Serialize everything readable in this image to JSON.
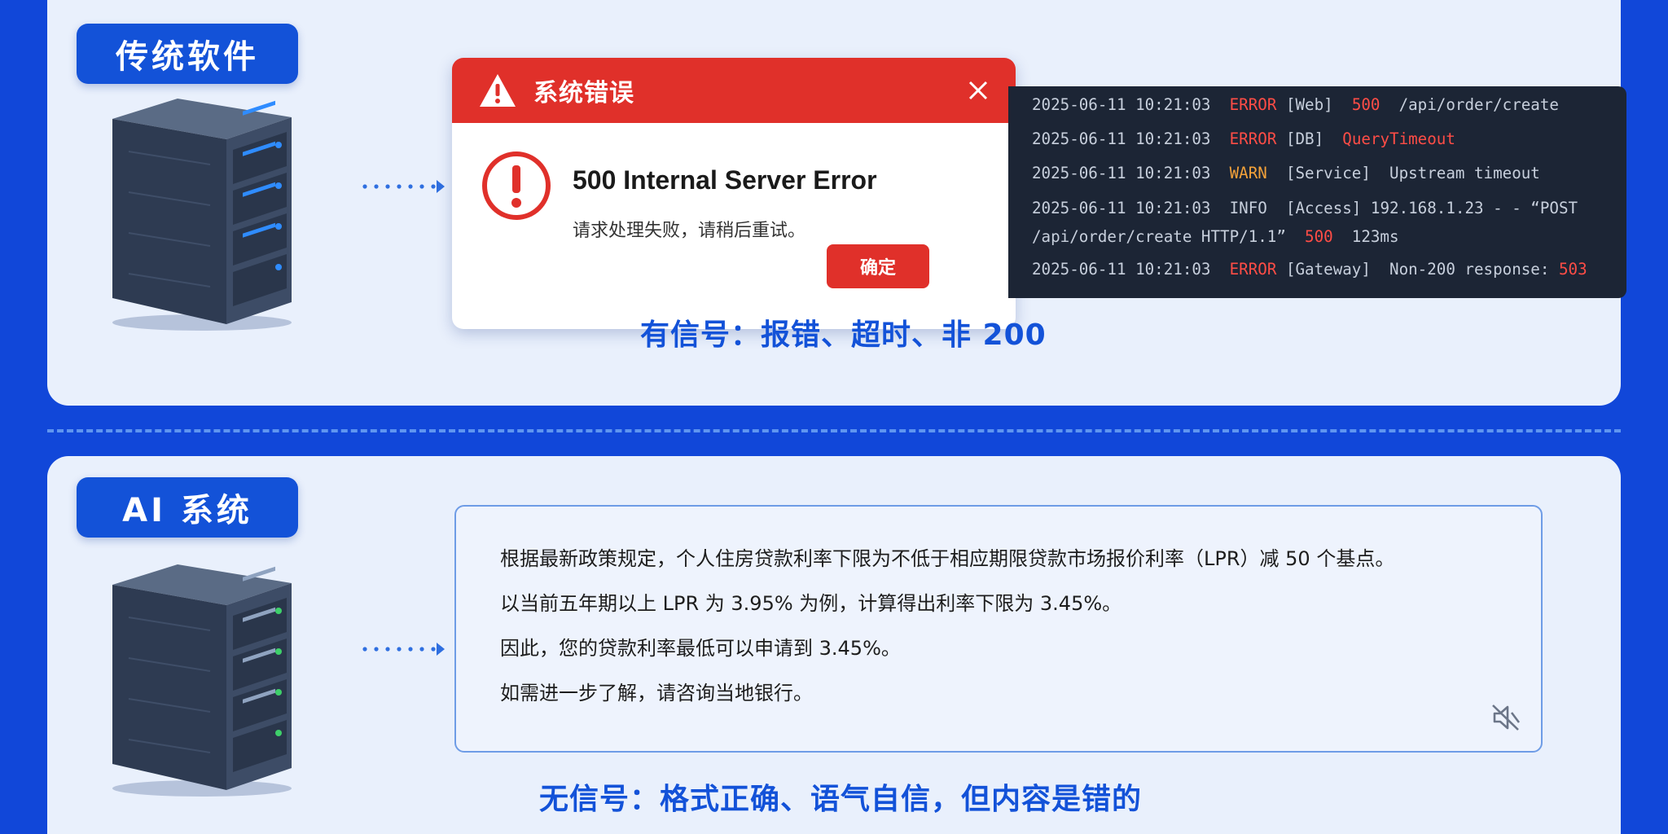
{
  "traditional": {
    "badge": "传统软件",
    "dialog": {
      "title": "系统错误",
      "error_title": "500 Internal Server Error",
      "error_desc": "请求处理失败，请稍后重试。",
      "ok_label": "确定"
    },
    "logs": [
      {
        "ts": "2025-06-11 10:21:03",
        "level": "ERROR",
        "src": "[Web]",
        "code": "500",
        "msg": "/api/order/create"
      },
      {
        "ts": "2025-06-11 10:21:03",
        "level": "ERROR",
        "src": "[DB]",
        "code": "QueryTimeout",
        "msg": ""
      },
      {
        "ts": "2025-06-11 10:21:03",
        "level": "WARN",
        "src": "[Service]",
        "code": "",
        "msg": "Upstream timeout"
      },
      {
        "ts": "2025-06-11 10:21:03",
        "level": "INFO",
        "src": "[Access]",
        "msg1": "192.168.1.23 - - “POST",
        "msg2": "/api/order/create HTTP/1.1”",
        "code": "500",
        "msg3": "123ms"
      },
      {
        "ts": "2025-06-11 10:21:03",
        "level": "ERROR",
        "src": "[Gateway]",
        "msg": "Non-200 response:",
        "code": "503"
      }
    ],
    "caption": "有信号：报错、超时、非 200"
  },
  "ai": {
    "badge": "AI 系统",
    "answer_lines": [
      "根据最新政策规定，个人住房贷款利率下限为不低于相应期限贷款市场报价利率（LPR）减 50 个基点。",
      "以当前五年期以上 LPR 为 3.95% 为例，计算得出利率下限为 3.45%。",
      "因此，您的贷款利率最低可以申请到 3.45%。",
      "如需进一步了解，请咨询当地银行。"
    ],
    "caption": "无信号：格式正确、语气自信，但内容是错的"
  },
  "colors": {
    "background": "#1147d9",
    "panel": "#e9f0fc",
    "accent": "#1352d8",
    "error_red": "#e0302a",
    "console_bg": "#1c2535",
    "traditional_led": "#2f8cff",
    "ai_led": "#3ed06a"
  },
  "icons": [
    "server-icon",
    "dotted-arrow-icon",
    "warning-triangle-icon",
    "close-icon",
    "error-circle-icon",
    "mute-speaker-icon"
  ]
}
